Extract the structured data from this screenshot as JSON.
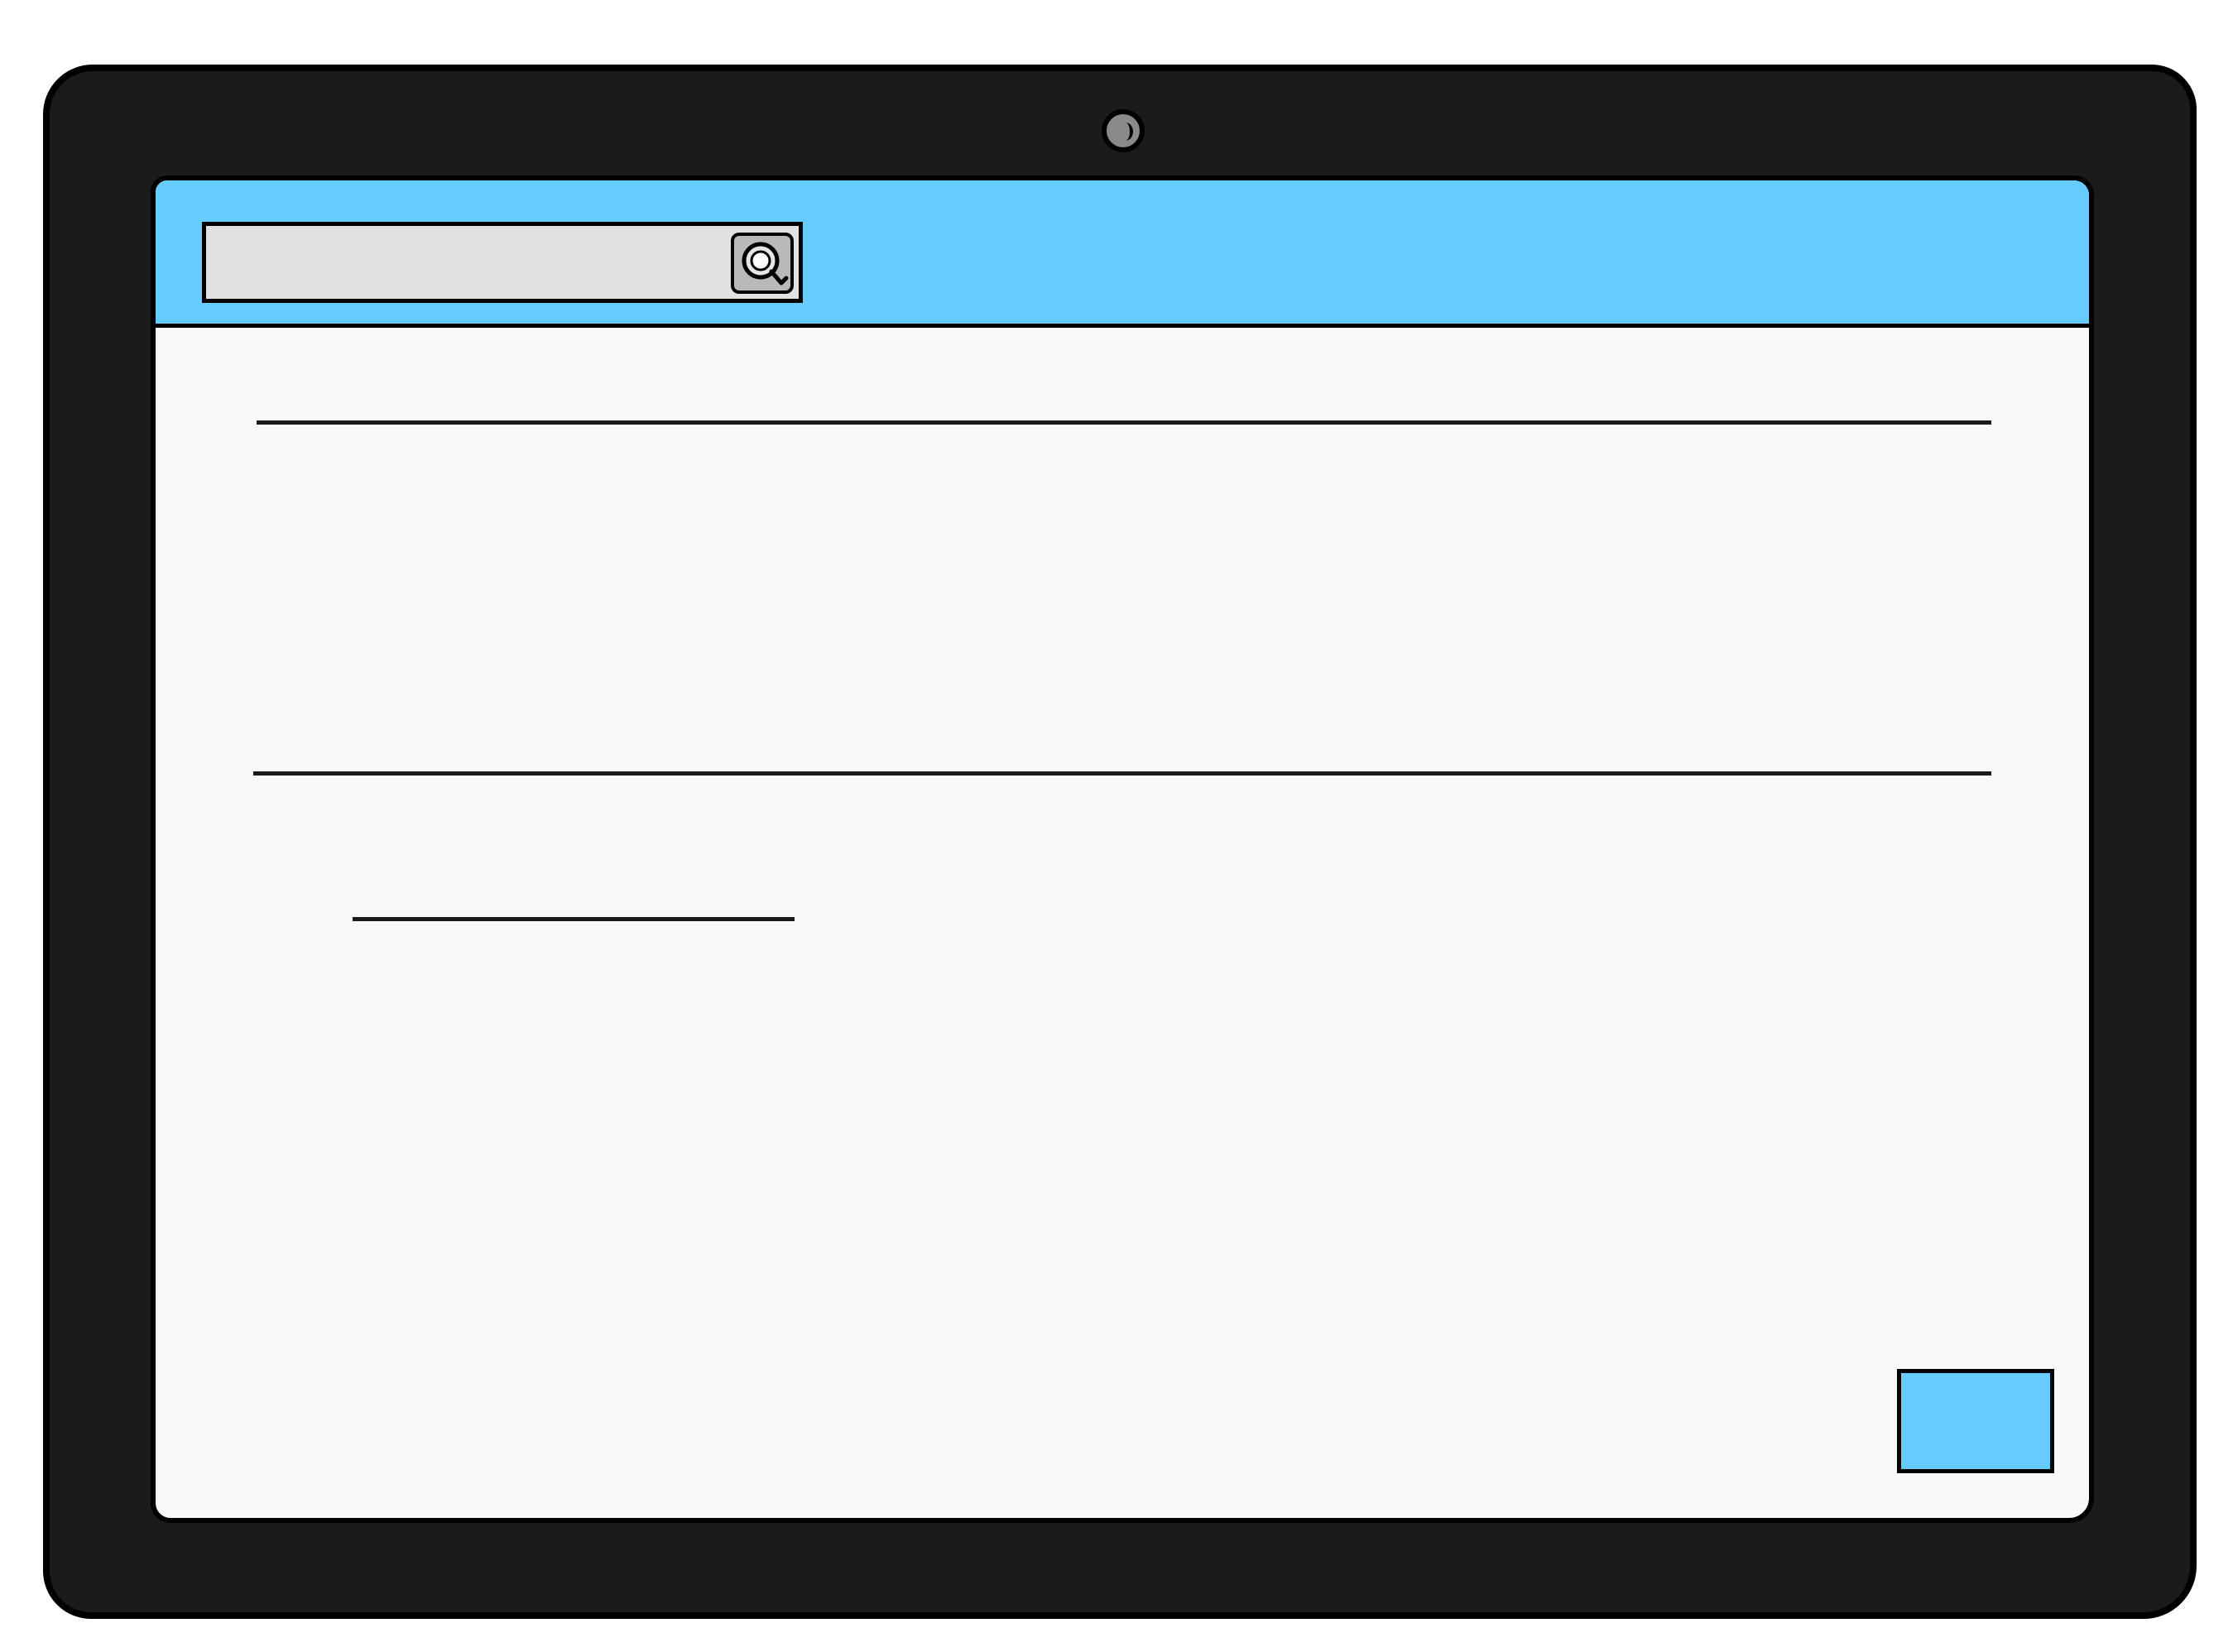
{
  "device": {
    "type": "tablet",
    "frame_color": "#1b1b1b",
    "camera_icon": "camera-icon"
  },
  "toolbar": {
    "background_color": "#66ccff",
    "search": {
      "value": "",
      "placeholder": "",
      "field_color": "#e2e2e2",
      "icon": "search-icon"
    }
  },
  "content": {
    "background_color": "#fbf9f7",
    "placeholder_lines": 3
  },
  "action_button": {
    "label": "",
    "color": "#66ccff"
  }
}
